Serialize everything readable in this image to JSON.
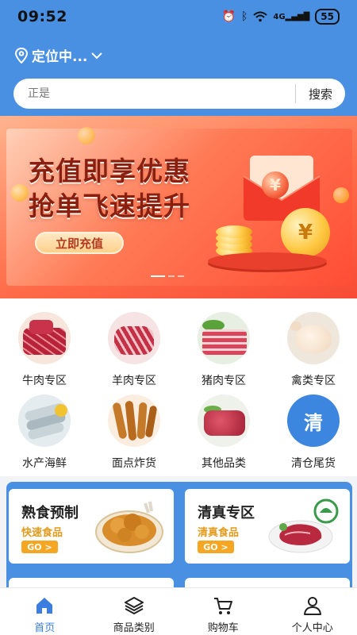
{
  "status_bar": {
    "time": "09:52",
    "signal": "4G",
    "battery": "55"
  },
  "header": {
    "location_label": "定位中...",
    "search": {
      "placeholder": "正是",
      "button_label": "搜索"
    },
    "accent_color": "#4a90e2"
  },
  "banner": {
    "title_line1": "充值即享优惠",
    "title_line2": "抢单飞速提升",
    "button_label": "立即充值",
    "currency_symbol": "¥"
  },
  "categories": [
    {
      "label": "牛肉专区",
      "icon": "beef-image"
    },
    {
      "label": "羊肉专区",
      "icon": "lamb-image"
    },
    {
      "label": "猪肉专区",
      "icon": "pork-image"
    },
    {
      "label": "禽类专区",
      "icon": "poultry-image"
    },
    {
      "label": "水产海鲜",
      "icon": "seafood-image"
    },
    {
      "label": "面点炸货",
      "icon": "fried-dough-image"
    },
    {
      "label": "其他品类",
      "icon": "other-meat-image"
    },
    {
      "label": "清仓尾货",
      "icon": "clearance-badge",
      "badge_text": "清"
    }
  ],
  "promos": [
    {
      "title": "熟食预制",
      "subtitle": "快速食品",
      "go_label": "GO >"
    },
    {
      "title": "清真专区",
      "subtitle": "清真食品",
      "go_label": "GO >"
    }
  ],
  "tabbar": {
    "items": [
      {
        "label": "首页",
        "icon": "home-icon",
        "active": true
      },
      {
        "label": "商品类别",
        "icon": "layers-icon",
        "active": false
      },
      {
        "label": "购物车",
        "icon": "cart-icon",
        "active": false
      },
      {
        "label": "个人中心",
        "icon": "user-icon",
        "active": false
      }
    ],
    "active_color": "#3b7ee0"
  }
}
